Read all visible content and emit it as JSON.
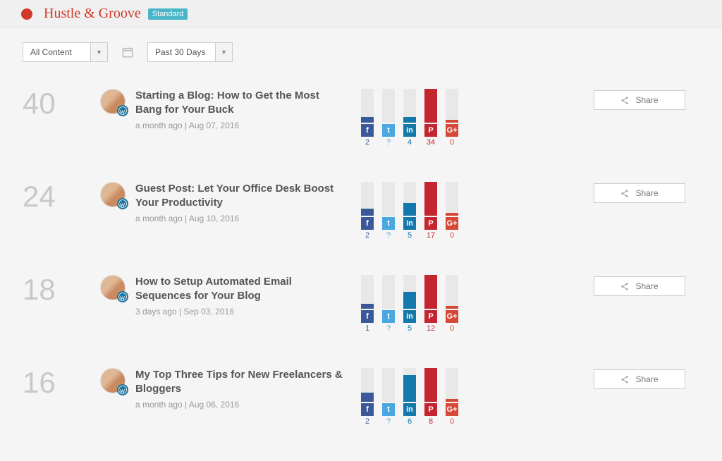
{
  "header": {
    "site": "Hustle & Groove",
    "plan": "Standard"
  },
  "filters": {
    "content": "All Content",
    "range": "Past 30 Days"
  },
  "labels": {
    "share": "Share"
  },
  "networks": [
    {
      "key": "facebook",
      "css": "fb",
      "valClass": "fb-c",
      "glyph": "f"
    },
    {
      "key": "twitter",
      "css": "tw",
      "valClass": "tw-c",
      "glyph": "t"
    },
    {
      "key": "linkedin",
      "css": "li",
      "valClass": "li-c",
      "glyph": "in"
    },
    {
      "key": "pinterest",
      "css": "pin",
      "valClass": "pin-c",
      "glyph": "P"
    },
    {
      "key": "google",
      "css": "gp",
      "valClass": "gp-c",
      "glyph": "G+"
    }
  ],
  "posts": [
    {
      "score": "40",
      "title": "Starting a Blog: How to Get the Most Bang for Your Buck",
      "time": "a month ago | Aug 07, 2016",
      "shares": {
        "facebook": "2",
        "twitter": "?",
        "linkedin": "4",
        "pinterest": "34",
        "google": "0"
      },
      "heights": {
        "facebook": 8,
        "twitter": 0,
        "linkedin": 8,
        "pinterest": 48,
        "google": 4
      }
    },
    {
      "score": "24",
      "title": "Guest Post: Let Your Office Desk Boost Your Productivity",
      "time": "a month ago | Aug 10, 2016",
      "shares": {
        "facebook": "2",
        "twitter": "?",
        "linkedin": "5",
        "pinterest": "17",
        "google": "0"
      },
      "heights": {
        "facebook": 10,
        "twitter": 0,
        "linkedin": 18,
        "pinterest": 48,
        "google": 4
      }
    },
    {
      "score": "18",
      "title": "How to Setup Automated Email Sequences for Your Blog",
      "time": "3 days ago | Sep 03, 2016",
      "shares": {
        "facebook": "1",
        "twitter": "?",
        "linkedin": "5",
        "pinterest": "12",
        "google": "0"
      },
      "heights": {
        "facebook": 7,
        "twitter": 0,
        "linkedin": 24,
        "pinterest": 48,
        "google": 4
      }
    },
    {
      "score": "16",
      "title": "My Top Three Tips for New Freelancers & Bloggers",
      "time": "a month ago | Aug 06, 2016",
      "shares": {
        "facebook": "2",
        "twitter": "?",
        "linkedin": "6",
        "pinterest": "8",
        "google": "0"
      },
      "heights": {
        "facebook": 13,
        "twitter": 0,
        "linkedin": 38,
        "pinterest": 48,
        "google": 4
      }
    }
  ]
}
